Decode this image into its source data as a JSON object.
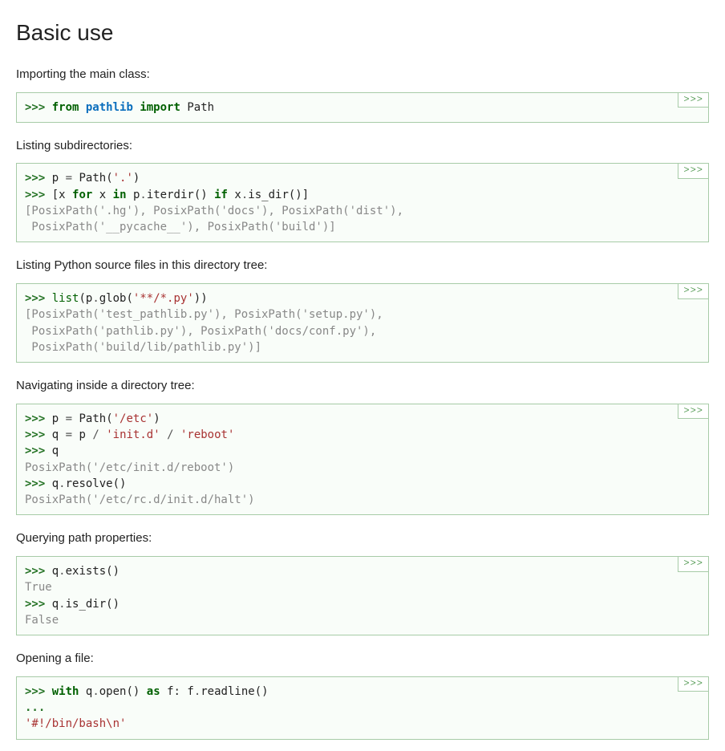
{
  "heading": "Basic use",
  "copybutton_label": ">>>",
  "sections": [
    {
      "desc": "Importing the main class:",
      "code_html": "<span class=\"gp\">&gt;&gt;&gt; </span><span class=\"k\">from</span> <span class=\"nn\">pathlib</span> <span class=\"k\">import</span> <span class=\"n\">Path</span>"
    },
    {
      "desc": "Listing subdirectories:",
      "code_html": "<span class=\"gp\">&gt;&gt;&gt; </span><span class=\"n\">p</span> <span class=\"o\">=</span> <span class=\"n\">Path</span><span class=\"p\">(</span><span class=\"s\">'.'</span><span class=\"p\">)</span>\n<span class=\"gp\">&gt;&gt;&gt; </span><span class=\"p\">[</span><span class=\"n\">x</span> <span class=\"k\">for</span> <span class=\"n\">x</span> <span class=\"k\">in</span> <span class=\"n\">p</span><span class=\"o\">.</span><span class=\"n\">iterdir</span><span class=\"p\">()</span> <span class=\"k\">if</span> <span class=\"n\">x</span><span class=\"o\">.</span><span class=\"n\">is_dir</span><span class=\"p\">()]</span>\n<span class=\"go\">[PosixPath('.hg'), PosixPath('docs'), PosixPath('dist'),</span>\n<span class=\"go\"> PosixPath('__pycache__'), PosixPath('build')]</span>"
    },
    {
      "desc": "Listing Python source files in this directory tree:",
      "code_html": "<span class=\"gp\">&gt;&gt;&gt; </span><span class=\"nb\">list</span><span class=\"p\">(</span><span class=\"n\">p</span><span class=\"o\">.</span><span class=\"n\">glob</span><span class=\"p\">(</span><span class=\"s\">'**/*.py'</span><span class=\"p\">))</span>\n<span class=\"go\">[PosixPath('test_pathlib.py'), PosixPath('setup.py'),</span>\n<span class=\"go\"> PosixPath('pathlib.py'), PosixPath('docs/conf.py'),</span>\n<span class=\"go\"> PosixPath('build/lib/pathlib.py')]</span>"
    },
    {
      "desc": "Navigating inside a directory tree:",
      "code_html": "<span class=\"gp\">&gt;&gt;&gt; </span><span class=\"n\">p</span> <span class=\"o\">=</span> <span class=\"n\">Path</span><span class=\"p\">(</span><span class=\"s\">'/etc'</span><span class=\"p\">)</span>\n<span class=\"gp\">&gt;&gt;&gt; </span><span class=\"n\">q</span> <span class=\"o\">=</span> <span class=\"n\">p</span> <span class=\"o\">/</span> <span class=\"s\">'init.d'</span> <span class=\"o\">/</span> <span class=\"s\">'reboot'</span>\n<span class=\"gp\">&gt;&gt;&gt; </span><span class=\"n\">q</span>\n<span class=\"go\">PosixPath('/etc/init.d/reboot')</span>\n<span class=\"gp\">&gt;&gt;&gt; </span><span class=\"n\">q</span><span class=\"o\">.</span><span class=\"n\">resolve</span><span class=\"p\">()</span>\n<span class=\"go\">PosixPath('/etc/rc.d/init.d/halt')</span>"
    },
    {
      "desc": "Querying path properties:",
      "code_html": "<span class=\"gp\">&gt;&gt;&gt; </span><span class=\"n\">q</span><span class=\"o\">.</span><span class=\"n\">exists</span><span class=\"p\">()</span>\n<span class=\"go\">True</span>\n<span class=\"gp\">&gt;&gt;&gt; </span><span class=\"n\">q</span><span class=\"o\">.</span><span class=\"n\">is_dir</span><span class=\"p\">()</span>\n<span class=\"go\">False</span>"
    },
    {
      "desc": "Opening a file:",
      "code_html": "<span class=\"gp\">&gt;&gt;&gt; </span><span class=\"k\">with</span> <span class=\"n\">q</span><span class=\"o\">.</span><span class=\"n\">open</span><span class=\"p\">()</span> <span class=\"k\">as</span> <span class=\"n\">f</span><span class=\"p\">:</span> <span class=\"n\">f</span><span class=\"o\">.</span><span class=\"n\">readline</span><span class=\"p\">()</span>\n<span class=\"gp\">...</span>\n<span class=\"s\">'#!/bin/bash\\n'</span>"
    }
  ]
}
